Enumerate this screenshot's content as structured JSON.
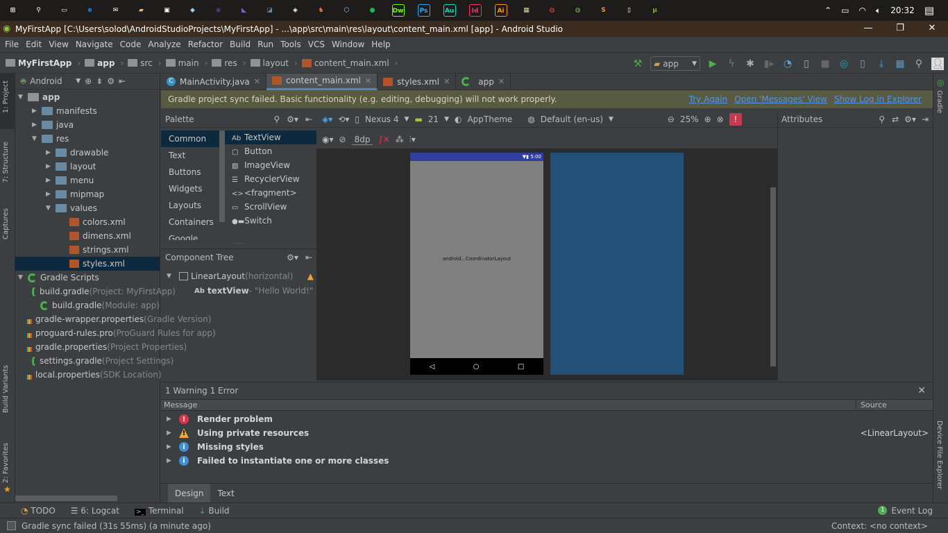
{
  "taskbar": {
    "apps": [
      {
        "icon": "windows-start-icon",
        "label": "⊞",
        "color": "#ffffff"
      },
      {
        "icon": "search-icon",
        "label": "⚲",
        "color": "#ffffff"
      },
      {
        "icon": "task-view-icon",
        "label": "▭",
        "color": "#ffffff"
      },
      {
        "icon": "edge-icon",
        "label": "e",
        "color": "#1e88e5"
      },
      {
        "icon": "mail-icon",
        "label": "✉",
        "color": "#ffffff"
      },
      {
        "icon": "file-explorer-icon",
        "label": "▰",
        "color": "#f5c542"
      },
      {
        "icon": "store-icon",
        "label": "▣",
        "color": "#ffffff"
      },
      {
        "icon": "app-cube-icon",
        "label": "◆",
        "color": "#9ecbf0"
      },
      {
        "icon": "eclipse-icon",
        "label": "◉",
        "color": "#4a3f8c"
      },
      {
        "icon": "visual-studio-icon",
        "label": "◣",
        "color": "#865fc5"
      },
      {
        "icon": "mysql-workbench-icon",
        "label": "◪",
        "color": "#5b8db8"
      },
      {
        "icon": "unity-icon",
        "label": "◈",
        "color": "#ffffff"
      },
      {
        "icon": "gitlab-icon",
        "label": "♞",
        "color": "#e8743b"
      },
      {
        "icon": "virtualbox-icon",
        "label": "⬡",
        "color": "#9ecbf0"
      },
      {
        "icon": "spotify-icon",
        "label": "●",
        "color": "#1db954"
      },
      {
        "icon": "dreamweaver-icon",
        "label": "Dw",
        "color": "#72ff00"
      },
      {
        "icon": "photoshop-icon",
        "label": "Ps",
        "color": "#31a8ff"
      },
      {
        "icon": "audition-icon",
        "label": "Au",
        "color": "#00e4bb"
      },
      {
        "icon": "indesign-icon",
        "label": "Id",
        "color": "#ff3366"
      },
      {
        "icon": "illustrator-icon",
        "label": "Ai",
        "color": "#ff9a00"
      },
      {
        "icon": "tool-icon",
        "label": "▦",
        "color": "#d8d8a0"
      },
      {
        "icon": "chrome-icon",
        "label": "◍",
        "color": "#e8453c"
      },
      {
        "icon": "globe-app-icon",
        "label": "◍",
        "color": "#6dbe45"
      },
      {
        "icon": "sublime-text-icon",
        "label": "S",
        "color": "#f49a1c"
      },
      {
        "icon": "notepad-icon",
        "label": "▯",
        "color": "#ffffff"
      },
      {
        "icon": "utorrent-icon",
        "label": "µ",
        "color": "#76b82a"
      }
    ],
    "clock": "20:32"
  },
  "window": {
    "title": "MyFirstApp [C:\\Users\\solod\\AndroidStudioProjects\\MyFirstApp] - ...\\app\\src\\main\\res\\layout\\content_main.xml [app] - Android Studio"
  },
  "menu": [
    "File",
    "Edit",
    "View",
    "Navigate",
    "Code",
    "Analyze",
    "Refactor",
    "Build",
    "Run",
    "Tools",
    "VCS",
    "Window",
    "Help"
  ],
  "breadcrumb": [
    "MyFirstApp",
    "app",
    "src",
    "main",
    "res",
    "layout",
    "content_main.xml"
  ],
  "run_config": "app",
  "project_panel": {
    "view": "Android",
    "tree": [
      {
        "label": "app",
        "indent": 0,
        "arrow": "▼",
        "type": "folder",
        "bold": true
      },
      {
        "label": "manifests",
        "indent": 1,
        "arrow": "▶",
        "type": "folder"
      },
      {
        "label": "java",
        "indent": 1,
        "arrow": "▶",
        "type": "folder"
      },
      {
        "label": "res",
        "indent": 1,
        "arrow": "▼",
        "type": "folder"
      },
      {
        "label": "drawable",
        "indent": 2,
        "arrow": "▶",
        "type": "folder"
      },
      {
        "label": "layout",
        "indent": 2,
        "arrow": "▶",
        "type": "folder"
      },
      {
        "label": "menu",
        "indent": 2,
        "arrow": "▶",
        "type": "folder"
      },
      {
        "label": "mipmap",
        "indent": 2,
        "arrow": "▶",
        "type": "folder"
      },
      {
        "label": "values",
        "indent": 2,
        "arrow": "▼",
        "type": "folder"
      },
      {
        "label": "colors.xml",
        "indent": 3,
        "arrow": "",
        "type": "xml"
      },
      {
        "label": "dimens.xml",
        "indent": 3,
        "arrow": "",
        "type": "xml"
      },
      {
        "label": "strings.xml",
        "indent": 3,
        "arrow": "",
        "type": "xml"
      },
      {
        "label": "styles.xml",
        "indent": 3,
        "arrow": "",
        "type": "xml",
        "selected": true
      },
      {
        "label": "Gradle Scripts",
        "indent": 0,
        "arrow": "▼",
        "type": "gradle"
      },
      {
        "label": "build.gradle",
        "hint": " (Project: MyFirstApp)",
        "indent": 1,
        "arrow": "",
        "type": "gradle"
      },
      {
        "label": "build.gradle",
        "hint": " (Module: app)",
        "indent": 1,
        "arrow": "",
        "type": "gradle"
      },
      {
        "label": "gradle-wrapper.properties",
        "hint": " (Gradle Version)",
        "indent": 1,
        "arrow": "",
        "type": "props"
      },
      {
        "label": "proguard-rules.pro",
        "hint": " (ProGuard Rules for app)",
        "indent": 1,
        "arrow": "",
        "type": "file"
      },
      {
        "label": "gradle.properties",
        "hint": " (Project Properties)",
        "indent": 1,
        "arrow": "",
        "type": "props"
      },
      {
        "label": "settings.gradle",
        "hint": " (Project Settings)",
        "indent": 1,
        "arrow": "",
        "type": "gradle"
      },
      {
        "label": "local.properties",
        "hint": " (SDK Location)",
        "indent": 1,
        "arrow": "",
        "type": "props"
      }
    ]
  },
  "left_stripe": [
    "1: Project",
    "7: Structure",
    "Captures",
    "Build Variants",
    "2: Favorites"
  ],
  "right_stripe": [
    "Gradle",
    "Device File Explorer"
  ],
  "tabs": [
    {
      "label": "MainActivity.java",
      "icon": "java-class-icon"
    },
    {
      "label": "content_main.xml",
      "icon": "xml-file-icon",
      "active": true
    },
    {
      "label": "styles.xml",
      "icon": "xml-file-icon"
    },
    {
      "label": "app",
      "icon": "gradle-icon"
    }
  ],
  "banner": {
    "message": "Gradle project sync failed. Basic functionality (e.g. editing, debugging) will not work properly.",
    "links": [
      "Try Again",
      "Open 'Messages' View",
      "Show Log in Explorer"
    ]
  },
  "palette": {
    "title": "Palette",
    "categories": [
      "Common",
      "Text",
      "Buttons",
      "Widgets",
      "Layouts",
      "Containers",
      "Google"
    ],
    "selected_category": "Common",
    "items": [
      {
        "icon": "Ab",
        "label": "TextView"
      },
      {
        "icon": "▢",
        "label": "Button"
      },
      {
        "icon": "▨",
        "label": "ImageView"
      },
      {
        "icon": "☰",
        "label": "RecyclerView"
      },
      {
        "icon": "<>",
        "label": "<fragment>"
      },
      {
        "icon": "▭",
        "label": "ScrollView"
      },
      {
        "icon": "●▬",
        "label": "Switch"
      }
    ]
  },
  "component_tree": {
    "title": "Component Tree",
    "root": {
      "label": "LinearLayout",
      "detail": " (horizontal)"
    },
    "child": {
      "icon": "Ab",
      "label": "textView",
      "detail": " - \"Hello World!\""
    }
  },
  "design_toolbar": {
    "device": "Nexus 4",
    "api": "21",
    "theme": "AppTheme",
    "locale": "Default (en-us)",
    "zoom": "25%",
    "margin": "8dp"
  },
  "preview": {
    "status_time": "5:00",
    "placeholder": "android...CoordinatorLayout",
    "statusbar_color": "#303f9f",
    "screen_color": "#808080",
    "blueprint_color": "#235078"
  },
  "attributes": {
    "title": "Attributes"
  },
  "messages": {
    "summary": "1 Warning 1 Error",
    "col_message": "Message",
    "col_source": "Source",
    "rows": [
      {
        "type": "error",
        "text": "Render problem",
        "source": ""
      },
      {
        "type": "warning",
        "text": "Using private resources",
        "source": "<LinearLayout>"
      },
      {
        "type": "info",
        "text": "Missing styles",
        "source": ""
      },
      {
        "type": "info",
        "text": "Failed to instantiate one or more classes",
        "source": ""
      }
    ]
  },
  "design_tabs": [
    "Design",
    "Text"
  ],
  "bottom_tools": [
    "TODO",
    "6: Logcat",
    "Terminal",
    "Build"
  ],
  "event_log": "Event Log",
  "status": {
    "message": "Gradle sync failed (31s 55ms) (a minute ago)",
    "context": "Context: <no context>"
  },
  "colors": {
    "accent": "#4a88c7",
    "error": "#e0344c",
    "warning": "#f0a732",
    "info": "#3d8fd8",
    "link": "#5394ec"
  }
}
